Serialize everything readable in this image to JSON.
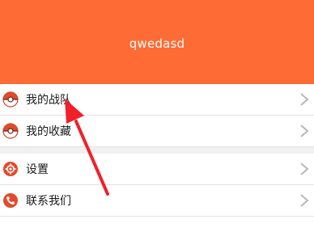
{
  "profile": {
    "username": "qwedasd"
  },
  "menu_top": [
    {
      "label": "我的战队",
      "icon": "pokeball-icon"
    },
    {
      "label": "我的收藏",
      "icon": "pokeball-icon"
    }
  ],
  "menu_bottom": [
    {
      "label": "设置",
      "icon": "settings-icon"
    },
    {
      "label": "联系我们",
      "icon": "phone-icon"
    }
  ],
  "colors": {
    "accent": "#ff6b35",
    "annotation": "#f0202a"
  }
}
